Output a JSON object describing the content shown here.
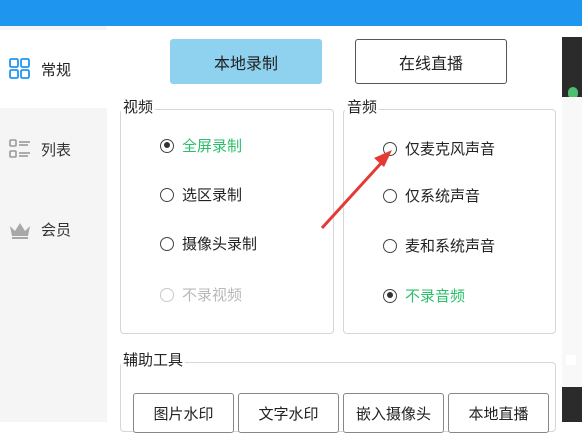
{
  "sidebar": {
    "items": [
      {
        "label": "常规",
        "icon": "grid-icon",
        "active": true
      },
      {
        "label": "列表",
        "icon": "list-icon",
        "active": false
      },
      {
        "label": "会员",
        "icon": "crown-icon",
        "active": false
      }
    ]
  },
  "mode_buttons": {
    "local_record": "本地录制",
    "live_stream": "在线直播"
  },
  "video_group": {
    "title": "视频",
    "options": [
      {
        "label": "全屏录制",
        "checked": true,
        "disabled": false
      },
      {
        "label": "选区录制",
        "checked": false,
        "disabled": false
      },
      {
        "label": "摄像头录制",
        "checked": false,
        "disabled": false
      },
      {
        "label": "不录视频",
        "checked": false,
        "disabled": true
      }
    ]
  },
  "audio_group": {
    "title": "音频",
    "options": [
      {
        "label": "仅麦克风声音",
        "checked": false,
        "disabled": false
      },
      {
        "label": "仅系统声音",
        "checked": false,
        "disabled": false
      },
      {
        "label": "麦和系统声音",
        "checked": false,
        "disabled": false
      },
      {
        "label": "不录音频",
        "checked": true,
        "disabled": false
      }
    ]
  },
  "tools_group": {
    "title": "辅助工具",
    "buttons": [
      "图片水印",
      "文字水印",
      "嵌入摄像头",
      "本地直播"
    ]
  },
  "colors": {
    "topbar": "#1e96f0",
    "accent_selected": "#8fd2f0",
    "checked_text": "#2dbf6b",
    "annotation_arrow": "#e53935"
  }
}
